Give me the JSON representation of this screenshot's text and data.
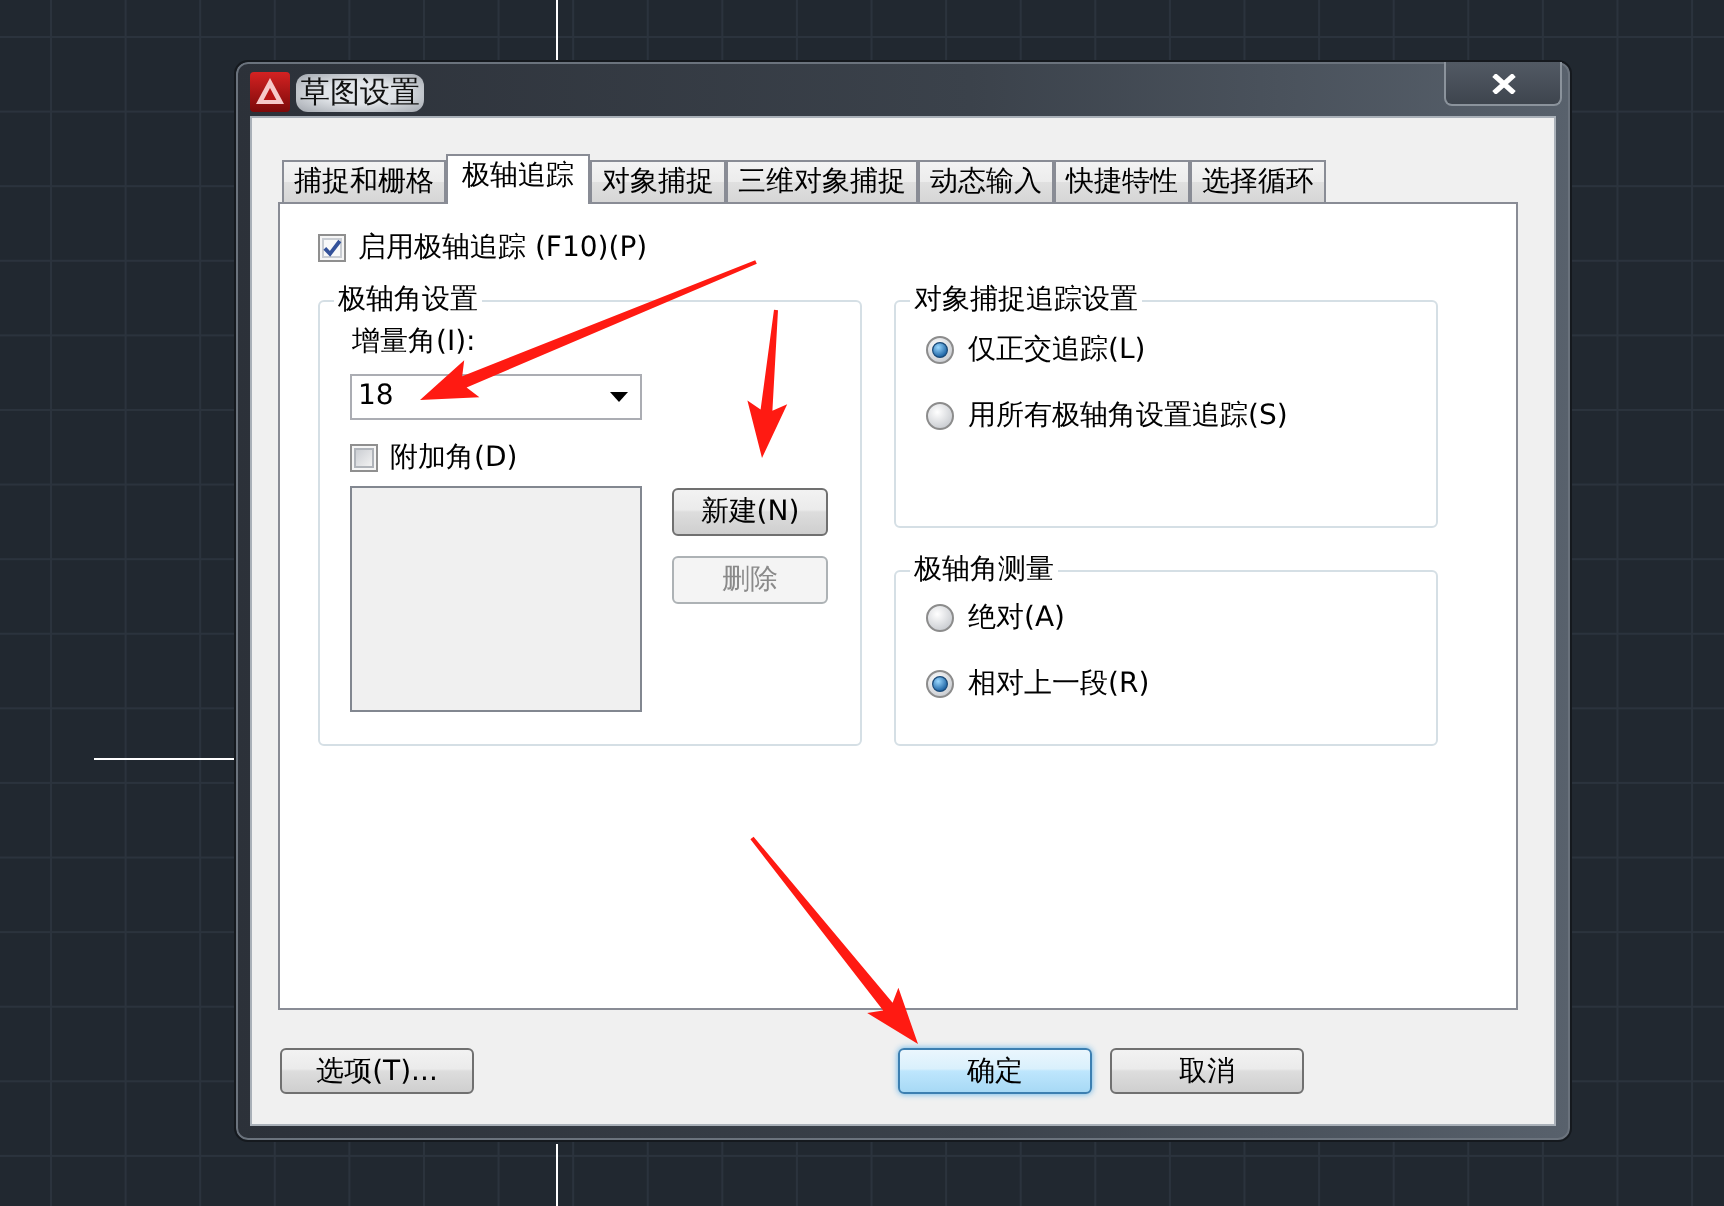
{
  "window": {
    "title": "草图设置"
  },
  "tabs": [
    {
      "label": "捕捉和栅格",
      "selected": false
    },
    {
      "label": "极轴追踪",
      "selected": true
    },
    {
      "label": "对象捕捉",
      "selected": false
    },
    {
      "label": "三维对象捕捉",
      "selected": false
    },
    {
      "label": "动态输入",
      "selected": false
    },
    {
      "label": "快捷特性",
      "selected": false
    },
    {
      "label": "选择循环",
      "selected": false
    }
  ],
  "enable_polar_tracking": {
    "label": "启用极轴追踪 (F10)(P)",
    "checked": true
  },
  "polar_angle_settings": {
    "title": "极轴角设置",
    "increment_angle": {
      "label": "增量角(I):",
      "value": "18"
    },
    "additional_angles": {
      "label": "附加角(D)",
      "checked": false
    },
    "buttons": [
      {
        "label": "新建(N)",
        "disabled": false
      },
      {
        "label": "删除",
        "disabled": true
      }
    ]
  },
  "object_snap_tracking": {
    "title": "对象捕捉追踪设置",
    "options": [
      {
        "label": "仅正交追踪(L)",
        "selected": true
      },
      {
        "label": "用所有极轴角设置追踪(S)",
        "selected": false
      }
    ]
  },
  "polar_angle_measurement": {
    "title": "极轴角测量",
    "options": [
      {
        "label": "绝对(A)",
        "selected": false
      },
      {
        "label": "相对上一段(R)",
        "selected": true
      }
    ]
  },
  "footer_buttons": [
    {
      "label": "选项(T)...",
      "default": false
    },
    {
      "label": "确定",
      "default": true
    },
    {
      "label": "取消",
      "default": false
    }
  ]
}
